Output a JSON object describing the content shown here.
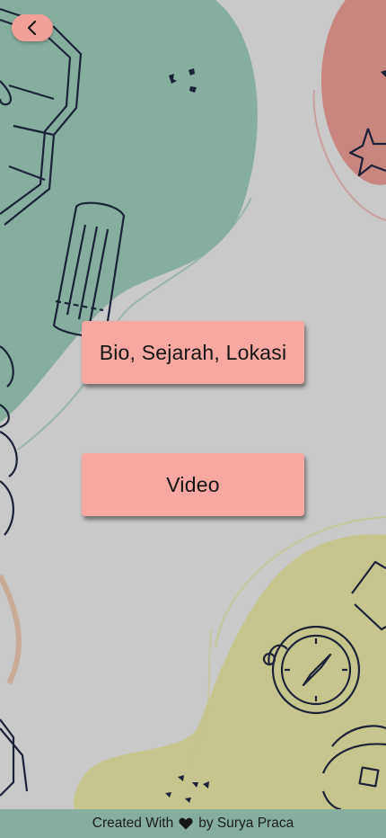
{
  "header": {
    "back_icon": "chevron-left-icon"
  },
  "menu": {
    "bio_label": "Bio, Sejarah, Lokasi",
    "video_label": "Video"
  },
  "footer": {
    "prefix": "Created With",
    "heart_icon": "heart-icon",
    "suffix": "by Surya Praca"
  },
  "colors": {
    "background": "#c9c9c9",
    "green_blob": "#86ad9e",
    "red_blob": "#c98580",
    "yellow_blob": "#c6c58e",
    "button": "#f8a8a3",
    "footer": "#86ad9e"
  }
}
